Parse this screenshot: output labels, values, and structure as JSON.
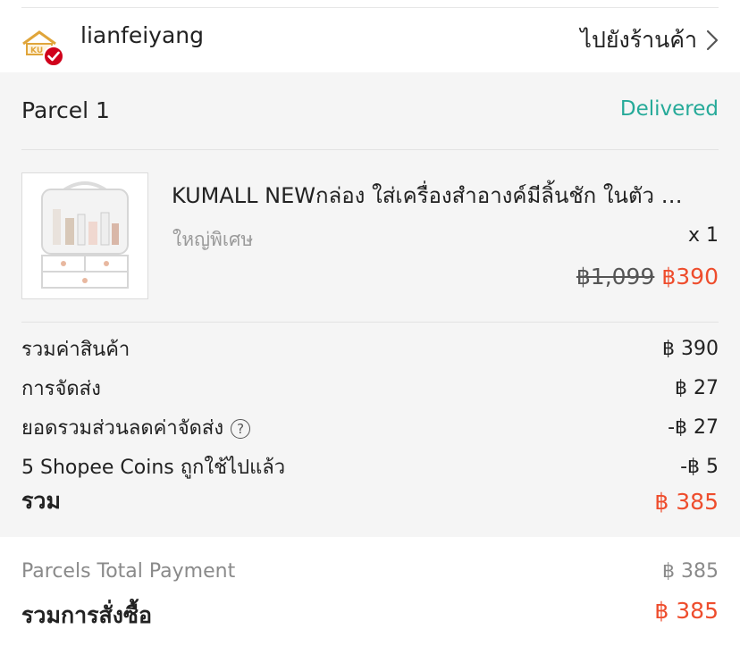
{
  "shop": {
    "name": "lianfeiyang",
    "go_label": "ไปยังร้านค้า",
    "logo_icon": "shop-logo-icon",
    "badge_icon": "verified-check-icon"
  },
  "parcel": {
    "title": "Parcel 1",
    "status": "Delivered"
  },
  "product": {
    "name": "KUMALL NEWกล่อง ใส่เครื่องสำอางค์มีลิ้นชัก ในตัว …",
    "variant": "ใหญ่พิเศษ",
    "qty": "x 1",
    "price_original": "฿1,099",
    "price_current": "฿390",
    "image_icon": "cosmetic-organizer-image"
  },
  "summary": {
    "items": [
      {
        "label": "รวมค่าสินค้า",
        "value": "฿ 390"
      },
      {
        "label": "การจัดส่ง",
        "value": "฿ 27"
      },
      {
        "label": "ยอดรวมส่วนลดค่าจัดส่ง",
        "value": "-฿ 27",
        "help": "?"
      },
      {
        "label": "5 Shopee Coins ถูกใช้ไปแล้ว",
        "value": "-฿ 5"
      }
    ],
    "total_label": "รวม",
    "total_value": "฿ 385"
  },
  "grand": {
    "parcels_label": "Parcels Total Payment",
    "parcels_value": "฿ 385",
    "order_label": "รวมการสั่งซื้อ",
    "order_value": "฿ 385"
  },
  "colors": {
    "accent": "#ee4d2d",
    "status": "#26aa99",
    "panel": "#f5f5f5"
  }
}
